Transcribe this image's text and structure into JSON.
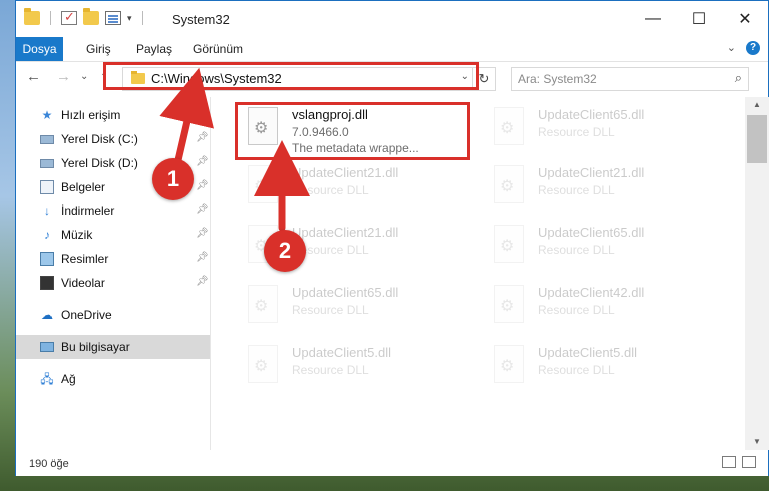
{
  "window": {
    "title": "System32",
    "controls": {
      "minimize": "—",
      "maximize": "☐",
      "close": "✕"
    }
  },
  "ribbon": {
    "tabs": [
      "Dosya",
      "Giriş",
      "Paylaş",
      "Görünüm"
    ],
    "expand": "⌄",
    "help": "?"
  },
  "nav": {
    "back": "←",
    "forward": "→",
    "recent": "⌄",
    "up": "↑"
  },
  "address": {
    "path": "C:\\Windows\\System32",
    "chevron": "⌄",
    "refresh": "↻"
  },
  "search": {
    "placeholder": "Ara: System32",
    "icon": "⌕"
  },
  "sidebar": {
    "items": [
      {
        "label": "Hızlı erişim",
        "icon": "star-icon"
      },
      {
        "label": "Yerel Disk (C:)",
        "icon": "drive-icon",
        "pinned": true
      },
      {
        "label": "Yerel Disk (D:)",
        "icon": "drive-icon",
        "pinned": true
      },
      {
        "label": "Belgeler",
        "icon": "documents-icon",
        "pinned": true
      },
      {
        "label": "İndirmeler",
        "icon": "downloads-icon",
        "pinned": true
      },
      {
        "label": "Müzik",
        "icon": "music-icon",
        "pinned": true
      },
      {
        "label": "Resimler",
        "icon": "pictures-icon",
        "pinned": true
      },
      {
        "label": "Videolar",
        "icon": "videos-icon",
        "pinned": true
      },
      {
        "label": "OneDrive",
        "icon": "cloud-icon"
      },
      {
        "label": "Bu bilgisayar",
        "icon": "computer-icon",
        "selected": true
      },
      {
        "label": "Ağ",
        "icon": "network-icon"
      }
    ]
  },
  "files": [
    {
      "name": "vslangproj.dll",
      "version": "7.0.9466.0",
      "desc": "The metadata wrappe...",
      "highlighted": true
    },
    {
      "name": "UpdateClient65.dll",
      "desc": "Resource DLL"
    },
    {
      "name": "UpdateClient21.dll",
      "desc": "Resource DLL"
    },
    {
      "name": "UpdateClient21.dll",
      "desc": "Resource DLL"
    },
    {
      "name": "UpdateClient21.dll",
      "desc": "Resource DLL"
    },
    {
      "name": "UpdateClient65.dll",
      "desc": "Resource DLL"
    },
    {
      "name": "UpdateClient65.dll",
      "desc": "Resource DLL"
    },
    {
      "name": "UpdateClient42.dll",
      "desc": "Resource DLL"
    },
    {
      "name": "UpdateClient5.dll",
      "desc": "Resource DLL"
    },
    {
      "name": "UpdateClient5.dll",
      "desc": "Resource DLL"
    }
  ],
  "status": {
    "count": "190 öğe"
  },
  "callouts": {
    "one": "1",
    "two": "2"
  },
  "colors": {
    "accent": "#1979ca",
    "highlight": "#d9302a"
  }
}
